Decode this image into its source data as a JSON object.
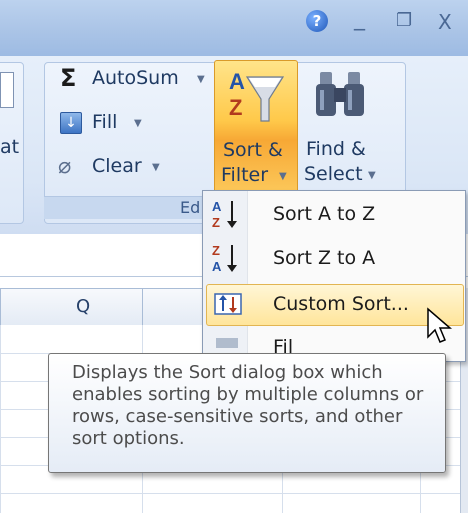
{
  "window": {
    "help_icon": "help-circle-icon",
    "minimize": "_",
    "restore": "❐",
    "close": "X"
  },
  "ribbon": {
    "cells_partial_label": "at",
    "editing": {
      "autosum_label": "AutoSum",
      "fill_label": "Fill",
      "clear_label": "Clear",
      "group_label": "Ed",
      "sort_filter": {
        "line1": "Sort &",
        "line2": "Filter"
      },
      "find_select": {
        "line1": "Find &",
        "line2": "Select"
      }
    }
  },
  "sheet": {
    "visible_column": "Q"
  },
  "menu": {
    "items": [
      {
        "label": "Sort A to Z",
        "icon": "sort-ascending-icon"
      },
      {
        "label": "Sort Z to A",
        "icon": "sort-descending-icon"
      },
      {
        "label": "Custom Sort...",
        "icon": "custom-sort-icon",
        "highlighted": true
      },
      {
        "label": "Fil",
        "icon": "filter-icon"
      }
    ]
  },
  "tooltip": {
    "text": "Displays the Sort dialog box which enables sorting by multiple columns or rows, case-sensitive sorts, and other sort options."
  },
  "colors": {
    "highlight": "#ffe59b",
    "ribbon_bg": "#dae6f6",
    "title_bg": "#a9c3e6"
  }
}
